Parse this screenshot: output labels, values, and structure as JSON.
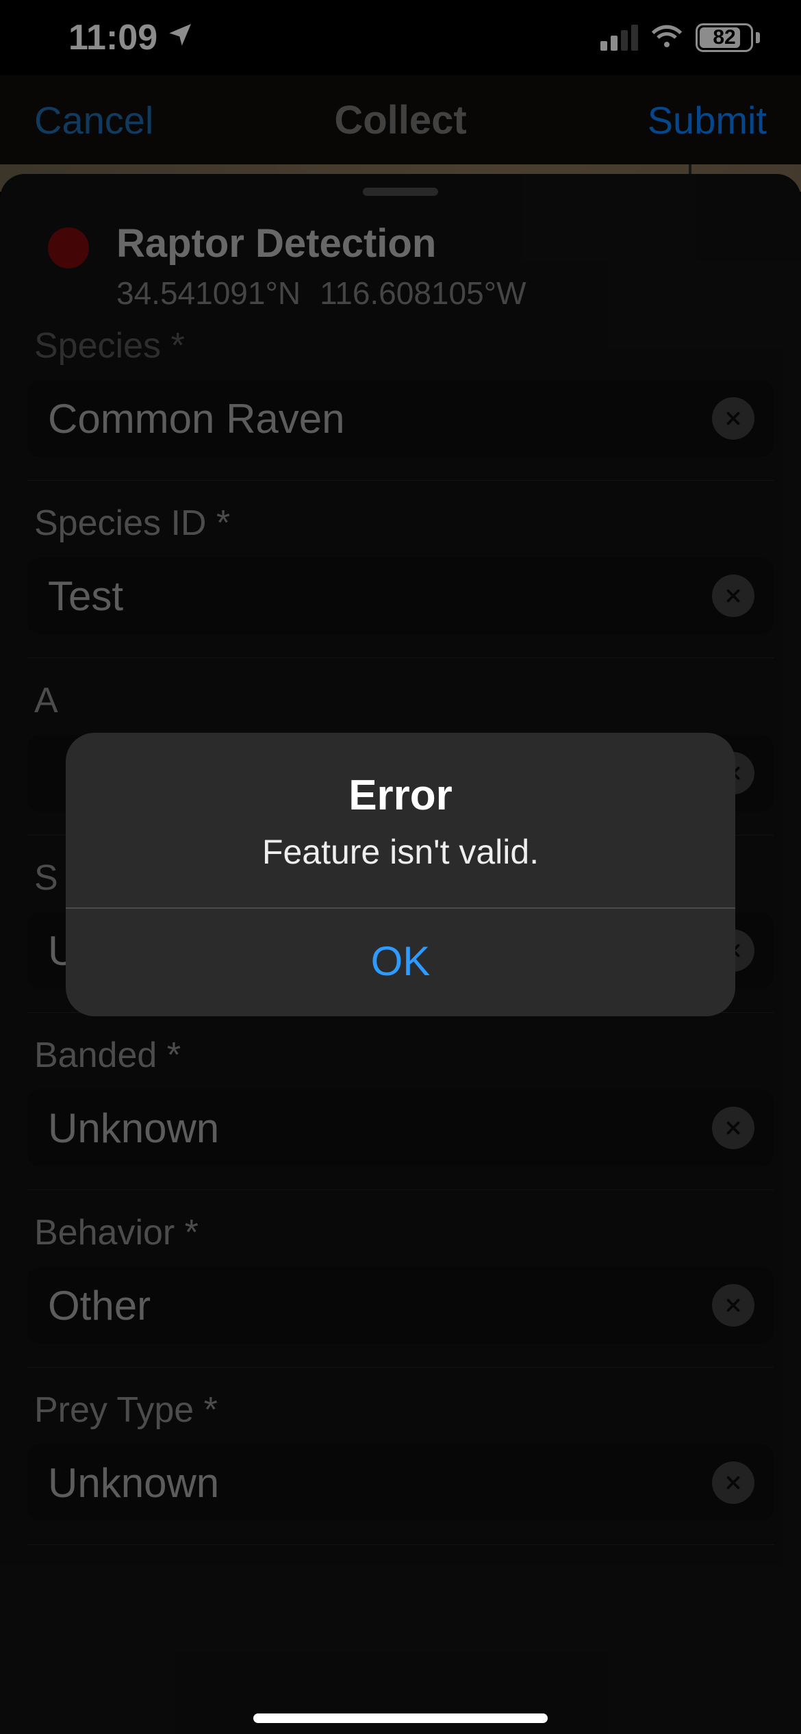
{
  "status": {
    "time": "11:09",
    "battery_pct": "82"
  },
  "nav": {
    "cancel": "Cancel",
    "title": "Collect",
    "submit": "Submit"
  },
  "sheet": {
    "title": "Raptor Detection",
    "lat": "34.541091°N",
    "lon": "116.608105°W"
  },
  "fields": {
    "species": {
      "label": "Species *",
      "value": "Common Raven"
    },
    "species_id": {
      "label": "Species ID *",
      "value": "Test"
    },
    "age": {
      "label": "A",
      "value": ""
    },
    "sex": {
      "label": "S",
      "value": "Unknown"
    },
    "banded": {
      "label": "Banded *",
      "value": "Unknown"
    },
    "behavior": {
      "label": "Behavior *",
      "value": "Other"
    },
    "prey_type": {
      "label": "Prey Type *",
      "value": "Unknown"
    }
  },
  "alert": {
    "title": "Error",
    "message": "Feature isn't valid.",
    "ok": "OK"
  }
}
